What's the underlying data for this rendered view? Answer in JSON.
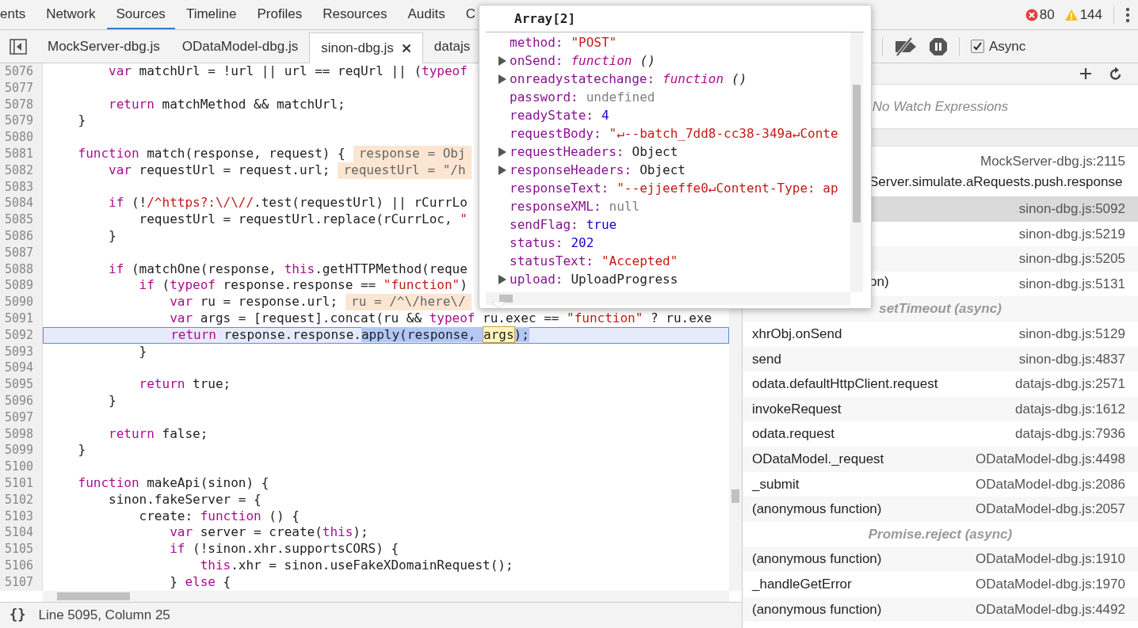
{
  "top_tabs": [
    {
      "label": "ents",
      "selected": false
    },
    {
      "label": "Network",
      "selected": false
    },
    {
      "label": "Sources",
      "selected": true
    },
    {
      "label": "Timeline",
      "selected": false
    },
    {
      "label": "Profiles",
      "selected": false
    },
    {
      "label": "Resources",
      "selected": false
    },
    {
      "label": "Audits",
      "selected": false
    },
    {
      "label": "C",
      "selected": false
    }
  ],
  "counters": {
    "errors": "80",
    "warnings": "144"
  },
  "file_tabs": [
    {
      "label": "MockServer-dbg.js",
      "selected": false
    },
    {
      "label": "ODataModel-dbg.js",
      "selected": false
    },
    {
      "label": "sinon-dbg.js",
      "selected": true
    },
    {
      "label": "datajs",
      "selected": false
    }
  ],
  "code_lines": [
    {
      "number": "5076",
      "current": false,
      "tokens": [
        {
          "kind": "keyword",
          "text": "        var"
        },
        {
          "kind": "plain",
          "text": " matchUrl = !url || url == reqUrl || ("
        },
        {
          "kind": "keyword",
          "text": "typeof"
        }
      ]
    },
    {
      "number": "5077",
      "current": false
    },
    {
      "number": "5078",
      "current": false,
      "tokens": [
        {
          "kind": "keyword",
          "text": "        return"
        },
        {
          "kind": "plain",
          "text": " matchMethod && matchUrl;"
        }
      ]
    },
    {
      "number": "5079",
      "current": false,
      "tokens": [
        {
          "kind": "plain",
          "text": "    }"
        }
      ]
    },
    {
      "number": "5080",
      "current": false
    },
    {
      "number": "5081",
      "current": false,
      "tokens": [
        {
          "kind": "keyword",
          "text": "    function"
        },
        {
          "kind": "plain",
          "text": " match(response, request) {"
        }
      ],
      "hint": "response = Obj"
    },
    {
      "number": "5082",
      "current": false,
      "tokens": [
        {
          "kind": "keyword",
          "text": "        var"
        },
        {
          "kind": "plain",
          "text": " requestUrl = request.url;"
        }
      ],
      "hint": "requestUrl = \"/h"
    },
    {
      "number": "5083",
      "current": false
    },
    {
      "number": "5084",
      "current": false,
      "tokens": [
        {
          "kind": "keyword",
          "text": "        if"
        },
        {
          "kind": "plain",
          "text": " (!"
        },
        {
          "kind": "string",
          "text": "/^https?:\\/\\//"
        },
        {
          "kind": "plain",
          "text": ".test(requestUrl) || rCurrLo"
        }
      ]
    },
    {
      "number": "5085",
      "current": false,
      "tokens": [
        {
          "kind": "plain",
          "text": "            requestUrl = requestUrl.replace(rCurrLoc, "
        },
        {
          "kind": "string",
          "text": "\""
        }
      ]
    },
    {
      "number": "5086",
      "current": false,
      "tokens": [
        {
          "kind": "plain",
          "text": "        }"
        }
      ]
    },
    {
      "number": "5087",
      "current": false
    },
    {
      "number": "5088",
      "current": false,
      "tokens": [
        {
          "kind": "keyword",
          "text": "        if"
        },
        {
          "kind": "plain",
          "text": " (matchOne(response, "
        },
        {
          "kind": "keyword",
          "text": "this"
        },
        {
          "kind": "plain",
          "text": ".getHTTPMethod(reque"
        }
      ]
    },
    {
      "number": "5089",
      "current": false,
      "tokens": [
        {
          "kind": "keyword",
          "text": "            if"
        },
        {
          "kind": "plain",
          "text": " ("
        },
        {
          "kind": "keyword",
          "text": "typeof"
        },
        {
          "kind": "plain",
          "text": " response.response == "
        },
        {
          "kind": "string",
          "text": "\"function\""
        },
        {
          "kind": "plain",
          "text": ")"
        }
      ]
    },
    {
      "number": "5090",
      "current": false,
      "tokens": [
        {
          "kind": "keyword",
          "text": "                var"
        },
        {
          "kind": "plain",
          "text": " ru = response.url;"
        }
      ],
      "hint": "ru = /^\\/here\\/"
    },
    {
      "number": "5091",
      "current": false,
      "tokens": [
        {
          "kind": "keyword",
          "text": "                var"
        },
        {
          "kind": "plain",
          "text": " args = [request].concat(ru && "
        },
        {
          "kind": "keyword",
          "text": "typeof"
        },
        {
          "kind": "plain",
          "text": " ru.exec == "
        },
        {
          "kind": "string",
          "text": "\"function\""
        },
        {
          "kind": "plain",
          "text": " ? ru.exe"
        }
      ]
    },
    {
      "number": "5092",
      "current": true,
      "tokens": [
        {
          "kind": "keyword",
          "text": "                return"
        },
        {
          "kind": "plain",
          "text": " response.response."
        },
        {
          "kind": "selection",
          "text": "apply(response, "
        },
        {
          "kind": "match",
          "text": "args"
        },
        {
          "kind": "selection",
          "text": ");"
        }
      ]
    },
    {
      "number": "5093",
      "current": false,
      "tokens": [
        {
          "kind": "plain",
          "text": "            }"
        }
      ]
    },
    {
      "number": "5094",
      "current": false
    },
    {
      "number": "5095",
      "current": false,
      "tokens": [
        {
          "kind": "keyword",
          "text": "            return"
        },
        {
          "kind": "plain",
          "text": " true;"
        }
      ]
    },
    {
      "number": "5096",
      "current": false,
      "tokens": [
        {
          "kind": "plain",
          "text": "        }"
        }
      ]
    },
    {
      "number": "5097",
      "current": false
    },
    {
      "number": "5098",
      "current": false,
      "tokens": [
        {
          "kind": "keyword",
          "text": "        return"
        },
        {
          "kind": "plain",
          "text": " false;"
        }
      ]
    },
    {
      "number": "5099",
      "current": false,
      "tokens": [
        {
          "kind": "plain",
          "text": "    }"
        }
      ]
    },
    {
      "number": "5100",
      "current": false
    },
    {
      "number": "5101",
      "current": false,
      "tokens": [
        {
          "kind": "keyword",
          "text": "    function"
        },
        {
          "kind": "plain",
          "text": " makeApi(sinon) {"
        }
      ]
    },
    {
      "number": "5102",
      "current": false,
      "tokens": [
        {
          "kind": "plain",
          "text": "        sinon.fakeServer = {"
        }
      ]
    },
    {
      "number": "5103",
      "current": false,
      "tokens": [
        {
          "kind": "plain",
          "text": "            create: "
        },
        {
          "kind": "keyword",
          "text": "function"
        },
        {
          "kind": "plain",
          "text": " () {"
        }
      ]
    },
    {
      "number": "5104",
      "current": false,
      "tokens": [
        {
          "kind": "keyword",
          "text": "                var"
        },
        {
          "kind": "plain",
          "text": " server = create("
        },
        {
          "kind": "keyword",
          "text": "this"
        },
        {
          "kind": "plain",
          "text": ");"
        }
      ]
    },
    {
      "number": "5105",
      "current": false,
      "tokens": [
        {
          "kind": "keyword",
          "text": "                if"
        },
        {
          "kind": "plain",
          "text": " (!sinon.xhr.supportsCORS) {"
        }
      ]
    },
    {
      "number": "5106",
      "current": false,
      "tokens": [
        {
          "kind": "keyword",
          "text": "                    this"
        },
        {
          "kind": "plain",
          "text": ".xhr = sinon.useFakeXDomainRequest();"
        }
      ]
    },
    {
      "number": "5107",
      "current": false,
      "tokens": [
        {
          "kind": "plain",
          "text": "                } "
        },
        {
          "kind": "keyword",
          "text": "else"
        },
        {
          "kind": "plain",
          "text": " {"
        }
      ]
    }
  ],
  "status_bar": {
    "pretty_print": "{}",
    "position": "Line 5095, Column 25"
  },
  "debugger_toolbar": {
    "async_label": "Async",
    "async_checked": true
  },
  "watch": {
    "empty_text": "No Watch Expressions"
  },
  "call_stack": [
    {
      "kind": "wrapped_frame",
      "name": "Server.simulate.aRequests.push.response",
      "location": "MockServer-dbg.js:2115",
      "selected": false
    },
    {
      "kind": "frame",
      "location": "sinon-dbg.js:5092",
      "selected": true
    },
    {
      "kind": "frame",
      "location": "sinon-dbg.js:5219",
      "selected": false
    },
    {
      "kind": "frame",
      "location": "sinon-dbg.js:5205",
      "selected": false
    },
    {
      "kind": "covered_frame",
      "name": "on)",
      "location": "sinon-dbg.js:5131",
      "selected": false
    },
    {
      "kind": "async",
      "label": "setTimeout (async)"
    },
    {
      "kind": "frame",
      "name": "xhrObj.onSend",
      "location": "sinon-dbg.js:5129",
      "selected": false
    },
    {
      "kind": "frame",
      "name": "send",
      "location": "sinon-dbg.js:4837",
      "selected": false
    },
    {
      "kind": "frame",
      "name": "odata.defaultHttpClient.request",
      "location": "datajs-dbg.js:2571",
      "selected": false
    },
    {
      "kind": "frame",
      "name": "invokeRequest",
      "location": "datajs-dbg.js:1612",
      "selected": false
    },
    {
      "kind": "frame",
      "name": "odata.request",
      "location": "datajs-dbg.js:7936",
      "selected": false
    },
    {
      "kind": "frame",
      "name": "ODataModel._request",
      "location": "ODataModel-dbg.js:4498",
      "selected": false
    },
    {
      "kind": "frame",
      "name": "_submit",
      "location": "ODataModel-dbg.js:2086",
      "selected": false
    },
    {
      "kind": "frame",
      "name": "(anonymous function)",
      "location": "ODataModel-dbg.js:2057",
      "selected": false
    },
    {
      "kind": "async",
      "label": "Promise.reject (async)"
    },
    {
      "kind": "frame",
      "name": "(anonymous function)",
      "location": "ODataModel-dbg.js:1910",
      "selected": false
    },
    {
      "kind": "frame",
      "name": "_handleGetError",
      "location": "ODataModel-dbg.js:1970",
      "selected": false
    },
    {
      "kind": "frame",
      "name": "(anonymous function)",
      "location": "ODataModel-dbg.js:4492",
      "selected": false
    }
  ],
  "popover": {
    "title": "Array[2]",
    "properties": [
      {
        "name": "method:",
        "kind": "string",
        "value": "\"POST\"",
        "expandable": false
      },
      {
        "name": "onSend:",
        "kind": "function",
        "value": "function",
        "signature": "()",
        "expandable": true
      },
      {
        "name": "onreadystatechange:",
        "kind": "function",
        "value": "function",
        "signature": "()",
        "expandable": true
      },
      {
        "name": "password:",
        "kind": "null",
        "value": "undefined",
        "expandable": false
      },
      {
        "name": "readyState:",
        "kind": "number",
        "value": "4",
        "expandable": false
      },
      {
        "name": "requestBody:",
        "kind": "string",
        "value": "\"↵--batch_7dd8-cc38-349a↵Conte",
        "expandable": false
      },
      {
        "name": "requestHeaders:",
        "kind": "object",
        "value": "Object",
        "expandable": true
      },
      {
        "name": "responseHeaders:",
        "kind": "object",
        "value": "Object",
        "expandable": true
      },
      {
        "name": "responseText:",
        "kind": "string",
        "value": "\"--ejjeeffe0↵Content-Type: ap",
        "expandable": false
      },
      {
        "name": "responseXML:",
        "kind": "null",
        "value": "null",
        "expandable": false
      },
      {
        "name": "sendFlag:",
        "kind": "number",
        "value": "true",
        "expandable": false
      },
      {
        "name": "status:",
        "kind": "number",
        "value": "202",
        "expandable": false
      },
      {
        "name": "statusText:",
        "kind": "string",
        "value": "\"Accepted\"",
        "expandable": false
      },
      {
        "name": "upload:",
        "kind": "object",
        "value": "UploadProgress",
        "expandable": true
      }
    ]
  }
}
